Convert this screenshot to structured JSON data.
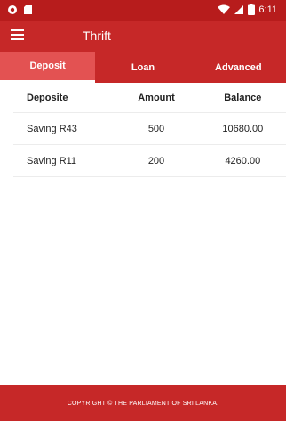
{
  "status_bar": {
    "time": "6:11"
  },
  "app_bar": {
    "title": "Thrift"
  },
  "tabs": [
    {
      "label": "Deposit",
      "active": true
    },
    {
      "label": "Loan",
      "active": false
    },
    {
      "label": "Advanced",
      "active": false
    }
  ],
  "table": {
    "headers": [
      "Deposite",
      "Amount",
      "Balance"
    ],
    "rows": [
      [
        "Saving R43",
        "500",
        "10680.00"
      ],
      [
        "Saving R11",
        "200",
        "4260.00"
      ]
    ]
  },
  "footer": {
    "text": "COPYRIGHT © THE PARLIAMENT OF SRI LANKA."
  },
  "colors": {
    "primary": "#c62828",
    "active_tab": "#e35252",
    "status_bar": "#b71c1c"
  }
}
